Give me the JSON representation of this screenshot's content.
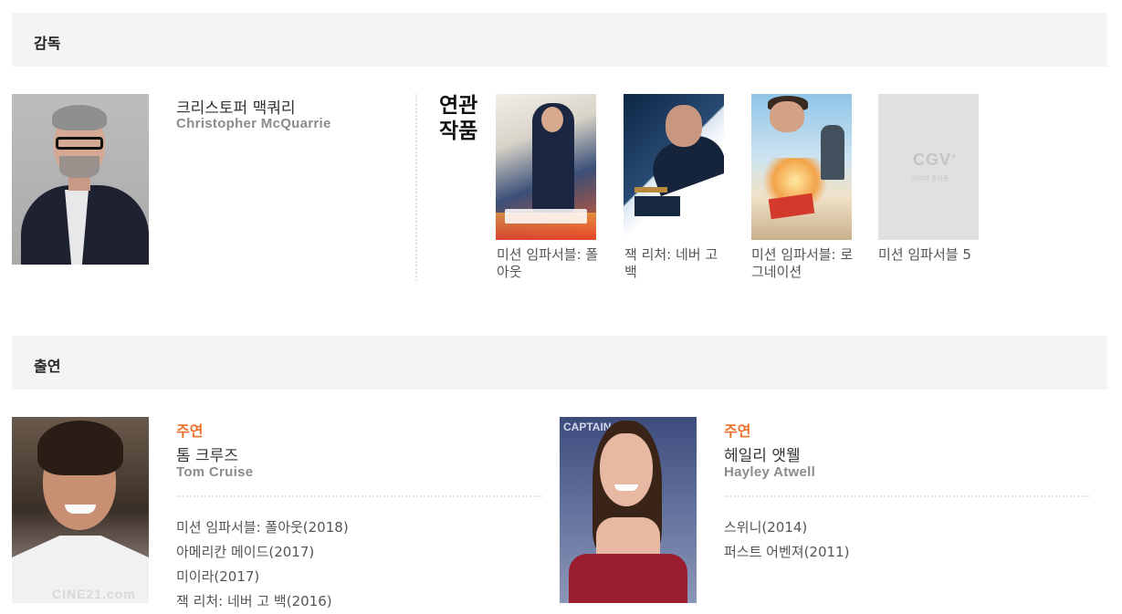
{
  "director_section": {
    "heading": "감독",
    "director": {
      "name_ko": "크리스토퍼 맥쿼리",
      "name_en": "Christopher McQuarrie"
    },
    "related_label": "연관 작품",
    "related_works": [
      {
        "title": "미션 임파서블: 폴아웃"
      },
      {
        "title": "잭 리처: 네버 고 백"
      },
      {
        "title": "미션 임파서블: 로그네이션"
      },
      {
        "title": "미션 임파서블 5",
        "placeholder_logo": "CGV",
        "placeholder_text": "이미지 준비중"
      }
    ]
  },
  "cast_section": {
    "heading": "출연",
    "cast": [
      {
        "role": "주연",
        "name_ko": "톰 크루즈",
        "name_en": "Tom Cruise",
        "watermark": "CINE21.com",
        "filmography": [
          "미션 임파서블: 폴아웃(2018)",
          "아메리칸 메이드(2017)",
          "미이라(2017)",
          "잭 리처: 네버 고 백(2016)"
        ]
      },
      {
        "role": "주연",
        "name_ko": "헤일리 앳웰",
        "name_en": "Hayley Atwell",
        "backdrop_text": "CAPTAIN",
        "filmography": [
          "스위니(2014)",
          "퍼스트 어벤져(2011)"
        ]
      }
    ]
  }
}
